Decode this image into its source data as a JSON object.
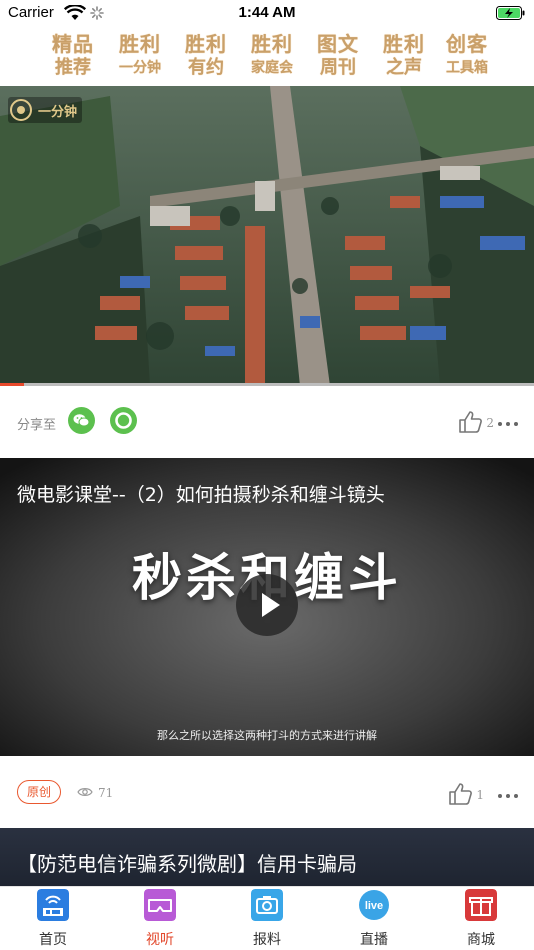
{
  "status_bar": {
    "carrier": "Carrier",
    "time": "1:44 AM"
  },
  "category_nav": [
    {
      "top": "精品",
      "bottom": "推荐"
    },
    {
      "top": "胜利",
      "bottom": "一分钟"
    },
    {
      "top": "胜利",
      "bottom": "有约"
    },
    {
      "top": "胜利",
      "bottom": "家庭会"
    },
    {
      "top": "图文",
      "bottom": "周刊"
    },
    {
      "top": "胜利",
      "bottom": "之声"
    },
    {
      "top": "创客",
      "bottom": "工具箱"
    }
  ],
  "video1": {
    "logo_text": "一分钟",
    "progress": 0.045,
    "share_label": "分享至",
    "like_count": "2"
  },
  "video2": {
    "title": "微电影课堂--（2）如何拍摄秒杀和缠斗镜头",
    "overlay_text": "秒杀和缠斗",
    "subtitle": "那么之所以选择这两种打斗的方式来进行讲解",
    "badge": "原创",
    "views": "71",
    "like_count": "1"
  },
  "video3": {
    "title": "【防范电信诈骗系列微剧】信用卡骗局"
  },
  "tab_bar": [
    {
      "label": "首页",
      "icon": "news-icon",
      "color": "#2b7de0",
      "active": false
    },
    {
      "label": "视听",
      "icon": "vr-glasses-icon",
      "color": "#b85ad6",
      "active": true
    },
    {
      "label": "报料",
      "icon": "camera-icon",
      "color": "#39a6e8",
      "active": false
    },
    {
      "label": "直播",
      "icon": "live-icon",
      "color": "#3aa4e6",
      "active": false
    },
    {
      "label": "商城",
      "icon": "gift-icon",
      "color": "#d8393a",
      "active": false
    }
  ],
  "colors": {
    "accent": "#e2462a",
    "category_gold": "#c9a06a",
    "wechat_green": "#5cc04e"
  }
}
